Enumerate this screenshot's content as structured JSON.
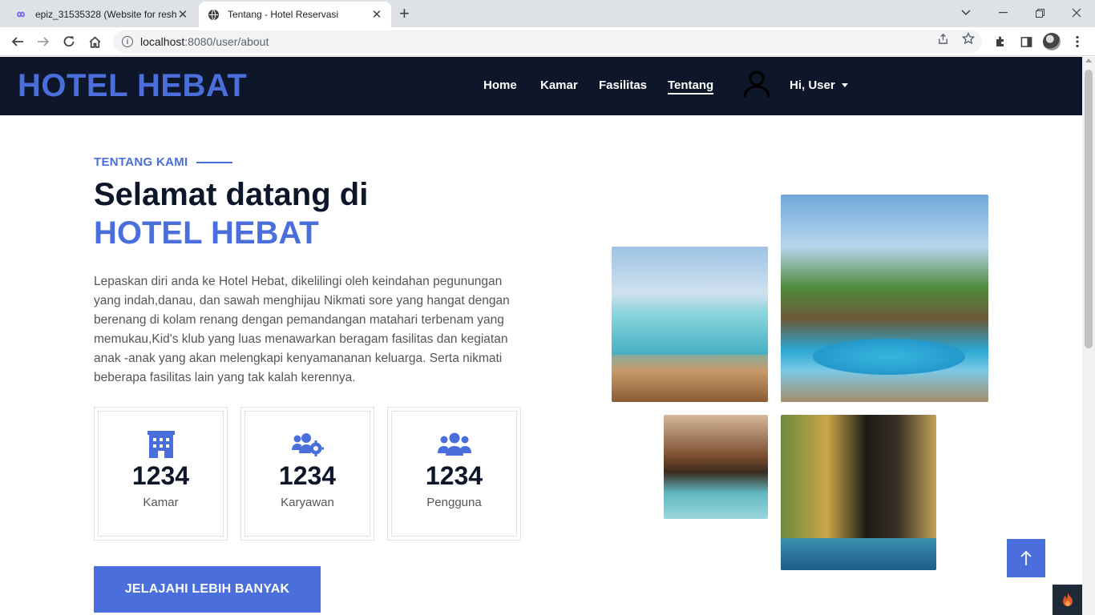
{
  "browser": {
    "tabs": [
      {
        "title": "epiz_31535328 (Website for resh",
        "active": false
      },
      {
        "title": "Tentang - Hotel Reservasi",
        "active": true
      }
    ],
    "url_host": "localhost",
    "url_rest": ":8080/user/about"
  },
  "nav": {
    "brand": "HOTEL HEBAT",
    "links": [
      "Home",
      "Kamar",
      "Fasilitas",
      "Tentang"
    ],
    "active_link": "Tentang",
    "user_menu": "Hi, User"
  },
  "about": {
    "label": "TENTANG KAMI",
    "heading_line1": "Selamat datang di",
    "heading_line2": "HOTEL HEBAT",
    "description": "Lepaskan diri anda ke Hotel Hebat, dikelilingi oleh keindahan pegunungan yang indah,danau, dan sawah menghijau Nikmati sore yang hangat dengan berenang di kolam renang dengan pemandangan matahari terbenam yang memukau,Kid's klub yang luas menawarkan beragam fasilitas dan kegiatan anak -anak yang akan melengkapi kenyamananan keluarga. Serta nikmati beberapa fasilitas lain yang tak kalah kerennya.",
    "stats": [
      {
        "icon": "building-icon",
        "value": "1234",
        "label": "Kamar"
      },
      {
        "icon": "users-cog-icon",
        "value": "1234",
        "label": "Karyawan"
      },
      {
        "icon": "users-icon",
        "value": "1234",
        "label": "Pengguna"
      }
    ],
    "cta": "JELAJAHI LEBIH BANYAK"
  },
  "colors": {
    "accent": "#4a6fdc",
    "navbar": "#0e1629"
  }
}
